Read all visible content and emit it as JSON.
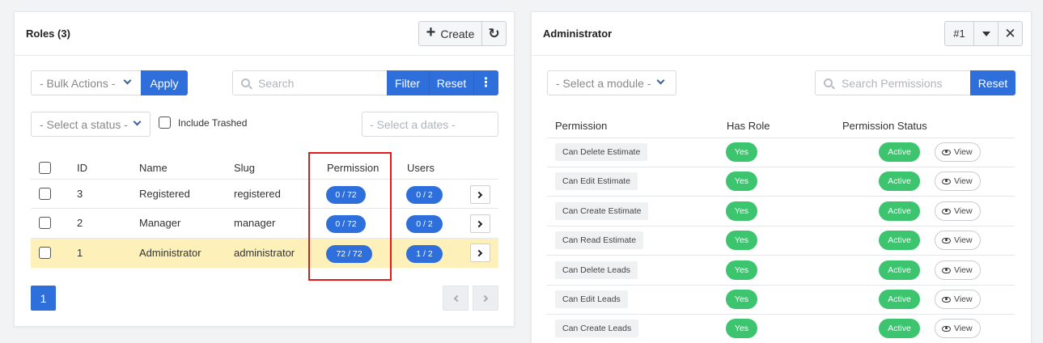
{
  "roles_panel": {
    "title": "Roles (3)",
    "create_label": "Create",
    "bulk_actions": "- Bulk Actions -",
    "apply_label": "Apply",
    "search_placeholder": "Search",
    "filter_label": "Filter",
    "reset_label": "Reset",
    "status_select": "- Select a status -",
    "include_trashed": "Include Trashed",
    "dates_placeholder": "- Select a dates -",
    "columns": [
      "ID",
      "Name",
      "Slug",
      "Permission",
      "Users"
    ],
    "rows": [
      {
        "id": "3",
        "name": "Registered",
        "slug": "registered",
        "permission": "0 / 72",
        "users": "0 / 2"
      },
      {
        "id": "2",
        "name": "Manager",
        "slug": "manager",
        "permission": "0 / 72",
        "users": "0 / 2"
      },
      {
        "id": "1",
        "name": "Administrator",
        "slug": "administrator",
        "permission": "72 / 72",
        "users": "1 / 2"
      }
    ],
    "page": "1",
    "highlight_color": "#fdf0b8",
    "annotation_color": "#e01b1b"
  },
  "detail_panel": {
    "title": "Administrator",
    "id_badge": "#1",
    "module_select": "- Select a module -",
    "search_placeholder": "Search Permissions",
    "reset_label": "Reset",
    "columns": [
      "Permission",
      "Has Role",
      "Permission Status"
    ],
    "rows": [
      {
        "permission": "Can Delete Estimate",
        "has_role": "Yes",
        "status": "Active",
        "action": "View"
      },
      {
        "permission": "Can Edit Estimate",
        "has_role": "Yes",
        "status": "Active",
        "action": "View"
      },
      {
        "permission": "Can Create Estimate",
        "has_role": "Yes",
        "status": "Active",
        "action": "View"
      },
      {
        "permission": "Can Read Estimate",
        "has_role": "Yes",
        "status": "Active",
        "action": "View"
      },
      {
        "permission": "Can Delete Leads",
        "has_role": "Yes",
        "status": "Active",
        "action": "View"
      },
      {
        "permission": "Can Edit Leads",
        "has_role": "Yes",
        "status": "Active",
        "action": "View"
      },
      {
        "permission": "Can Create Leads",
        "has_role": "Yes",
        "status": "Active",
        "action": "View"
      }
    ]
  },
  "colors": {
    "primary": "#2f6fdc",
    "success": "#3cc46e"
  }
}
